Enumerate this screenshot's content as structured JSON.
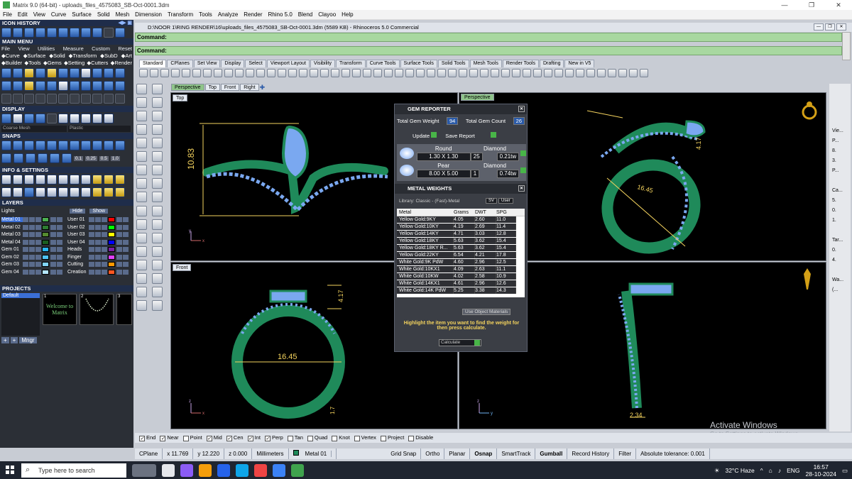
{
  "window": {
    "title": "Matrix 9.0 (64-bit) - uploads_files_4575083_SB-Oct-0001.3dm",
    "buttons": [
      "—",
      "❐",
      "✕"
    ]
  },
  "menubar": [
    "File",
    "Edit",
    "View",
    "Curve",
    "Surface",
    "Solid",
    "Mesh",
    "Dimension",
    "Transform",
    "Tools",
    "Analyze",
    "Render",
    "Rhino 5.0",
    "Blend",
    "Clayoo",
    "Help"
  ],
  "left": {
    "icon_history": "ICON HISTORY",
    "main_menu": "MAIN MENU",
    "main_menu_items": [
      "File",
      "View",
      "Utilities",
      "Measure",
      "Custom",
      "Reset"
    ],
    "row2": [
      "Curve",
      "Surface",
      "Solid",
      "Transform",
      "SubD",
      "Art"
    ],
    "row3": [
      "Builder",
      "Tools",
      "Gems",
      "Setting",
      "Cutters",
      "Render"
    ],
    "display": "DISPLAY",
    "display_mode": "Coarse Mesh",
    "display_mat": "Plastic",
    "snaps": "SNAPS",
    "snap_vals": [
      "0.1",
      "0.25",
      "0.5",
      "1.0"
    ],
    "info": "INFO & SETTINGS",
    "layers": "LAYERS",
    "lights": "Lights",
    "hide": "Hide",
    "show": "Show",
    "layer_left": [
      {
        "name": "Metal 01",
        "color": "#4caf50"
      },
      {
        "name": "Metal 02",
        "color": "#2e7d32"
      },
      {
        "name": "Metal 03",
        "color": "#558b2f"
      },
      {
        "name": "Metal 04",
        "color": "#1b5e20"
      },
      {
        "name": "Gem 01",
        "color": "#29b6f6"
      },
      {
        "name": "Gem 02",
        "color": "#4fc3f7"
      },
      {
        "name": "Gem 03",
        "color": "#81d4fa"
      },
      {
        "name": "Gem 04",
        "color": "#b3e5fc"
      }
    ],
    "layer_right": [
      {
        "name": "User 01",
        "color": "#ff0000"
      },
      {
        "name": "User 02",
        "color": "#00ff00"
      },
      {
        "name": "User 03",
        "color": "#ffff00"
      },
      {
        "name": "User 04",
        "color": "#0000ff"
      },
      {
        "name": "Heads",
        "color": "#7b1fa2"
      },
      {
        "name": "Finger",
        "color": "#e040fb"
      },
      {
        "name": "Cutting",
        "color": "#ff9800"
      },
      {
        "name": "Creation",
        "color": "#ff5722"
      }
    ],
    "projects": "PROJECTS",
    "project_default": "Default",
    "welcome1": "Welcome to",
    "welcome2": "Matrix",
    "thumbs": [
      "1",
      "2",
      "3"
    ],
    "mngr": "Mngr"
  },
  "doc": {
    "path": "D:\\NOOR 1\\RING RENDER\\16\\uploads_files_4575083_SB-Oct-0001.3dm (5589 KB) - Rhinoceros 5.0 Commercial",
    "command1": "Command:",
    "command2": "Command:"
  },
  "tabs": [
    "Standard",
    "CPlanes",
    "Set View",
    "Display",
    "Select",
    "Viewport Layout",
    "Visibility",
    "Transform",
    "Curve Tools",
    "Surface Tools",
    "Solid Tools",
    "Mesh Tools",
    "Render Tools",
    "Drafting",
    "New in V5"
  ],
  "viewport_tabs": [
    "Perspective",
    "Top",
    "Front",
    "Right"
  ],
  "viewports": {
    "top_label": "Top",
    "perspective_label": "Perspective",
    "front_label": "Front",
    "dim_top": "10.83",
    "dim_persp_a": "16.45",
    "dim_persp_b": "4.17",
    "dim_front_a": "16.45",
    "dim_front_b": "4.17",
    "dim_front_c": "1.7",
    "dim_right": "2.34",
    "axis_x": "x",
    "axis_y": "y",
    "axis_z": "z"
  },
  "gem_reporter": {
    "title": "GEM REPORTER",
    "weight_label": "Total Gem Weight",
    "weight_value": "94",
    "count_label": "Total Gem Count",
    "count_value": "26",
    "update": "Update",
    "save": "Save Report",
    "gems": [
      {
        "shape": "Round",
        "size": "1.30 X 1.30",
        "type": "Diamond",
        "count": "25",
        "ctw": "0.21tw"
      },
      {
        "shape": "Pear",
        "size": "8.00 X 5.00",
        "type": "Diamond",
        "count": "1",
        "ctw": "0.74tw"
      }
    ]
  },
  "metal_weights": {
    "title": "METAL WEIGHTS",
    "library": "Library: Classic - (Fast)-Metal",
    "btn_sv": "SV",
    "btn_user": "User",
    "headers": [
      "Metal",
      "Grams",
      "DWT",
      "SPG"
    ],
    "rows": [
      [
        "Yellow Gold:9KY",
        "4.05",
        "2.60",
        "11.0"
      ],
      [
        "Yellow Gold:10KY",
        "4.19",
        "2.69",
        "11.4"
      ],
      [
        "Yellow Gold:14KY",
        "4.71",
        "3.03",
        "12.8"
      ],
      [
        "Yellow Gold:18KY",
        "5.63",
        "3.62",
        "15.4"
      ],
      [
        "Yellow Gold:18KY R...",
        "5.63",
        "3.62",
        "15.4"
      ],
      [
        "Yellow Gold:22KY",
        "6.54",
        "4.21",
        "17.8"
      ],
      [
        "White Gold:9K PdW",
        "4.60",
        "2.96",
        "12.5"
      ],
      [
        "White Gold:10KX1",
        "4.09",
        "2.63",
        "11.1"
      ],
      [
        "White Gold:10KW",
        "4.02",
        "2.58",
        "10.9"
      ],
      [
        "White Gold:14KX1",
        "4.61",
        "2.96",
        "12.6"
      ],
      [
        "White Gold:14K PdW",
        "5.25",
        "3.38",
        "14.3"
      ]
    ],
    "use_object": "Use Object Materials",
    "hint": "Highlight the item you want to find the weight for then press calculate.",
    "calculate": "Calculate"
  },
  "right_col": [
    "Vie...",
    "P...",
    "8.",
    "3.",
    "P...",
    "Ca...",
    "5.",
    "0.",
    "1.",
    "Tar...",
    "0.",
    "4.",
    "Wa...",
    "(..."
  ],
  "osnap": [
    "End",
    "Near",
    "Point",
    "Mid",
    "Cen",
    "Int",
    "Perp",
    "Tan",
    "Quad",
    "Knot",
    "Vertex",
    "Project",
    "Disable"
  ],
  "osnap_checked": [
    true,
    true,
    false,
    true,
    true,
    true,
    true,
    false,
    false,
    false,
    false,
    false,
    false
  ],
  "status": {
    "cplane": "CPlane",
    "x": "x 11.769",
    "y": "y 12.220",
    "z": "z 0.000",
    "units": "Millimeters",
    "layer": "Metal 01",
    "grid_snap": "Grid Snap",
    "ortho": "Ortho",
    "planar": "Planar",
    "osnap": "Osnap",
    "smarttrack": "SmartTrack",
    "gumball": "Gumball",
    "record": "Record History",
    "filter": "Filter",
    "tolerance": "Absolute tolerance: 0.001"
  },
  "activate": {
    "line1": "Activate Windows",
    "line2": "Go to Settings to activate Windows."
  },
  "taskbar": {
    "search": "Type here to search",
    "weather": "32°C Haze",
    "lang": "ENG",
    "time": "16:57",
    "date": "28-10-2024"
  },
  "colors": {
    "metal": "#1f8a5a",
    "gem": "#7aa8f0",
    "dim": "#f4d35e"
  }
}
